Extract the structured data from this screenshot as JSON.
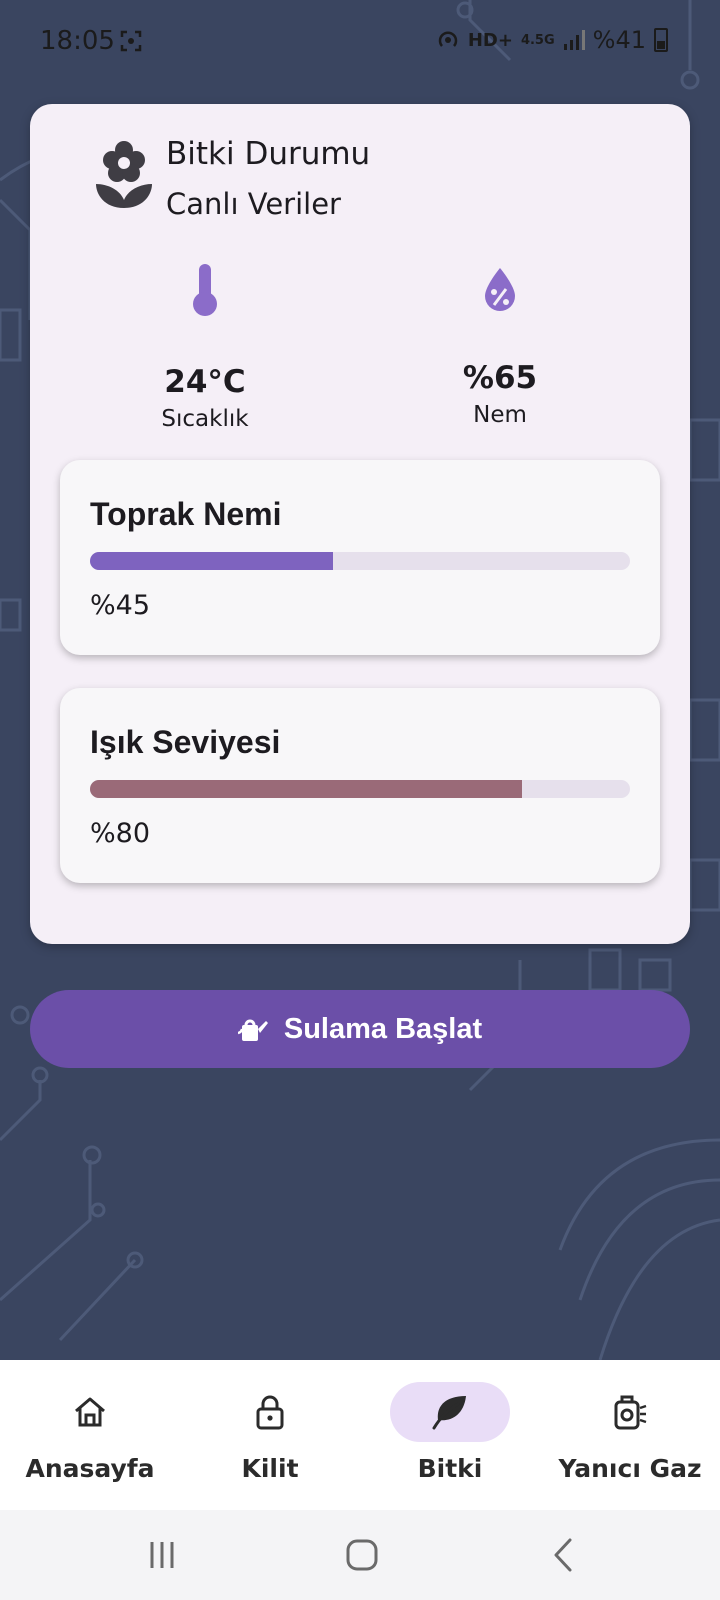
{
  "status_bar": {
    "time": "18:05",
    "network": "HD+",
    "signal": "4.5G",
    "battery": "%41"
  },
  "card": {
    "title": "Bitki Durumu",
    "subtitle": "Canlı Veriler",
    "temperature": {
      "value": "24°C",
      "label": "Sıcaklık"
    },
    "humidity": {
      "value": "%65",
      "label": "Nem"
    },
    "soil": {
      "title": "Toprak Nemi",
      "value_text": "%45",
      "level": 0.45,
      "color": "#7e63bf"
    },
    "light": {
      "title": "Işık Seviyesi",
      "value_text": "%80",
      "level": 0.8,
      "color": "#9a6a78"
    }
  },
  "action_button": {
    "label": "Sulama Başlat"
  },
  "bottom_nav": {
    "items": [
      {
        "label": "Anasayfa",
        "icon": "home-icon",
        "active": false
      },
      {
        "label": "Kilit",
        "icon": "lock-icon",
        "active": false
      },
      {
        "label": "Bitki",
        "icon": "leaf-icon",
        "active": true
      },
      {
        "label": "Yanıcı Gaz",
        "icon": "gas-icon",
        "active": false
      }
    ]
  },
  "colors": {
    "background": "#3a4560",
    "accent": "#6b4fa8",
    "icon_purple": "#8b6cc9",
    "card": "#f5eff7",
    "nav_active": "#e9ddf7"
  }
}
